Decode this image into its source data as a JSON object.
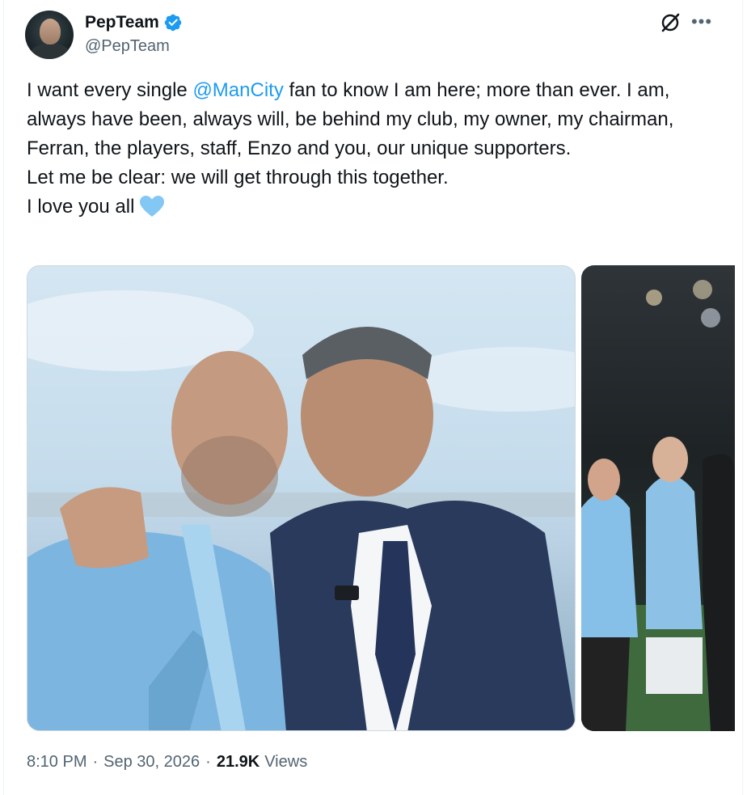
{
  "author": {
    "display_name": "PepTeam",
    "handle": "@PepTeam",
    "verified": true,
    "verified_color": "#1d9bf0"
  },
  "tweet": {
    "lines": [
      {
        "before": "I want every single ",
        "mention": "@ManCity",
        "after": " fan to know I am here; more than ever. I am, always have been, always will, be behind my club, my owner, my chairman, Ferran, the players, staff, Enzo and you, our unique supporters."
      },
      {
        "text": "Let me be clear: we will get through this together."
      },
      {
        "text": "I love you all"
      }
    ],
    "emoji": "light-blue-heart",
    "mention_color": "#1d9bf0"
  },
  "media": {
    "count": 2,
    "main": "photo-manager-and-chairman",
    "second": "photo-celebration"
  },
  "meta": {
    "time": "8:10 PM",
    "date": "Sep 30, 2026",
    "views_count": "21.9K",
    "views_label": "Views"
  },
  "icons": [
    "grok-icon",
    "more-icon",
    "verified-badge-icon",
    "blue-heart-icon"
  ]
}
